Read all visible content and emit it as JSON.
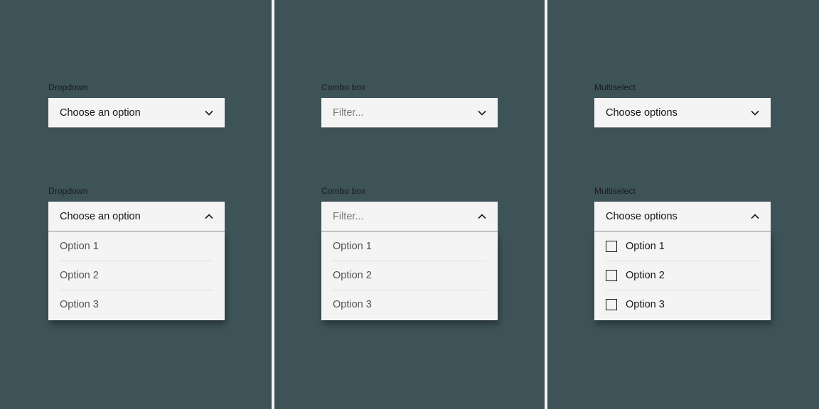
{
  "dropdown": {
    "label": "Dropdown",
    "placeholder": "Choose an option",
    "options": [
      "Option 1",
      "Option 2",
      "Option 3"
    ]
  },
  "combobox": {
    "label": "Combo box",
    "placeholder": "Filter...",
    "options": [
      "Option 1",
      "Option 2",
      "Option 3"
    ]
  },
  "multiselect": {
    "label": "Multiselect",
    "placeholder": "Choose options",
    "options": [
      "Option 1",
      "Option 2",
      "Option 3"
    ]
  }
}
